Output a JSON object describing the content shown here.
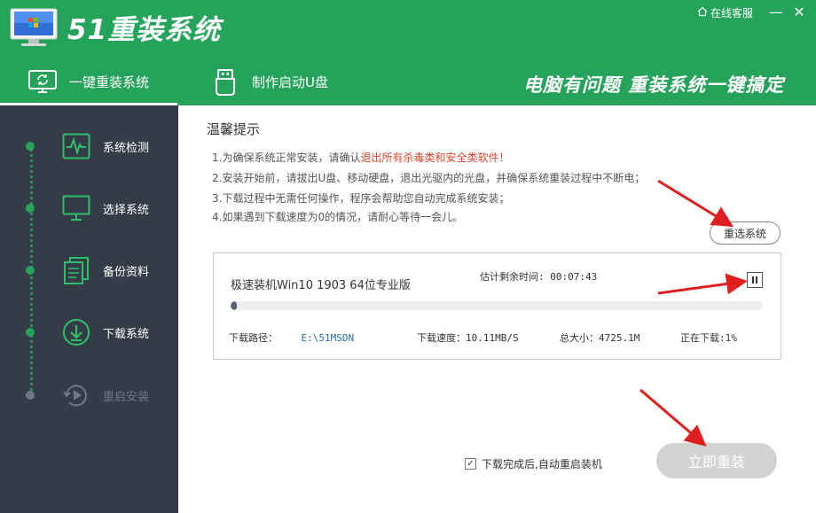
{
  "app": {
    "title": "51重装系统",
    "service_label": "在线客服",
    "minimize_glyph": "—",
    "close_glyph": "✕"
  },
  "tabs": [
    {
      "label": "一键重装系统",
      "icon": "refresh-monitor-icon",
      "active": true
    },
    {
      "label": "制作启动U盘",
      "icon": "usb-icon",
      "active": false
    }
  ],
  "slogan": "电脑有问题 重装系统一键搞定",
  "steps": [
    {
      "label": "系统检测",
      "icon": "pulse-monitor-icon",
      "state": "done"
    },
    {
      "label": "选择系统",
      "icon": "monitor-icon",
      "state": "done"
    },
    {
      "label": "备份资料",
      "icon": "documents-icon",
      "state": "done"
    },
    {
      "label": "下载系统",
      "icon": "download-icon",
      "state": "current"
    },
    {
      "label": "重启安装",
      "icon": "restart-play-icon",
      "state": "pending"
    }
  ],
  "tips": {
    "title": "温馨提示",
    "items": [
      {
        "text": "1.为确保系统正常安装，请确认",
        "highlight": "退出所有杀毒类和安全类软件！"
      },
      {
        "text": "2.安装开始前，请拔出U盘、移动硬盘，退出光驱内的光盘，并确保系统重装过程中不断电；",
        "highlight": ""
      },
      {
        "text": "3.下载过程中无需任何操作，程序会帮助您自动完成系统安装；",
        "highlight": ""
      },
      {
        "text": "4.如果遇到下载速度为0的情况，请耐心等待一会儿。",
        "highlight": ""
      }
    ]
  },
  "reselect_label": "重选系统",
  "download": {
    "name": "极速装机Win10 1903 64位专业版",
    "remaining_label": "估计剩余时间: 00:07:43",
    "progress": 0.01,
    "path_label": "下载路径：",
    "path_value": "E:\\51MSDN",
    "speed_label": "下载速度：10.11MB/S",
    "total_label": "总大小：4725.1M",
    "status_label": "正在下载:1%"
  },
  "auto_restart": {
    "label": "下载完成后,自动重启装机",
    "checked": true
  },
  "install_label": "立即重装",
  "colors": {
    "brand_green": "#25a35a",
    "sidebar_bg": "#343c48",
    "warning": "#e2452c",
    "arrow_red": "#e02020"
  }
}
